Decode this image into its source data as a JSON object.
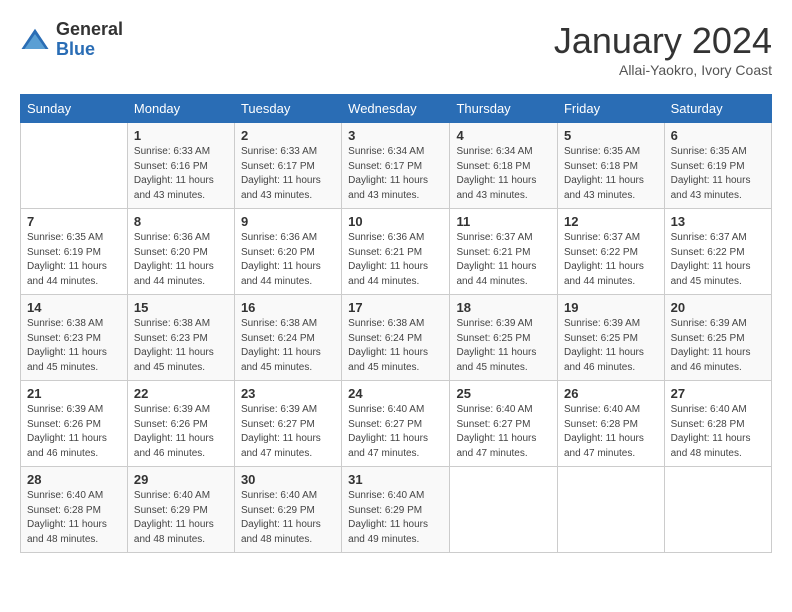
{
  "logo": {
    "general": "General",
    "blue": "Blue"
  },
  "header": {
    "month": "January 2024",
    "location": "Allai-Yaokro, Ivory Coast"
  },
  "days_of_week": [
    "Sunday",
    "Monday",
    "Tuesday",
    "Wednesday",
    "Thursday",
    "Friday",
    "Saturday"
  ],
  "weeks": [
    [
      {
        "day": "",
        "info": ""
      },
      {
        "day": "1",
        "info": "Sunrise: 6:33 AM\nSunset: 6:16 PM\nDaylight: 11 hours\nand 43 minutes."
      },
      {
        "day": "2",
        "info": "Sunrise: 6:33 AM\nSunset: 6:17 PM\nDaylight: 11 hours\nand 43 minutes."
      },
      {
        "day": "3",
        "info": "Sunrise: 6:34 AM\nSunset: 6:17 PM\nDaylight: 11 hours\nand 43 minutes."
      },
      {
        "day": "4",
        "info": "Sunrise: 6:34 AM\nSunset: 6:18 PM\nDaylight: 11 hours\nand 43 minutes."
      },
      {
        "day": "5",
        "info": "Sunrise: 6:35 AM\nSunset: 6:18 PM\nDaylight: 11 hours\nand 43 minutes."
      },
      {
        "day": "6",
        "info": "Sunrise: 6:35 AM\nSunset: 6:19 PM\nDaylight: 11 hours\nand 43 minutes."
      }
    ],
    [
      {
        "day": "7",
        "info": "Sunrise: 6:35 AM\nSunset: 6:19 PM\nDaylight: 11 hours\nand 44 minutes."
      },
      {
        "day": "8",
        "info": "Sunrise: 6:36 AM\nSunset: 6:20 PM\nDaylight: 11 hours\nand 44 minutes."
      },
      {
        "day": "9",
        "info": "Sunrise: 6:36 AM\nSunset: 6:20 PM\nDaylight: 11 hours\nand 44 minutes."
      },
      {
        "day": "10",
        "info": "Sunrise: 6:36 AM\nSunset: 6:21 PM\nDaylight: 11 hours\nand 44 minutes."
      },
      {
        "day": "11",
        "info": "Sunrise: 6:37 AM\nSunset: 6:21 PM\nDaylight: 11 hours\nand 44 minutes."
      },
      {
        "day": "12",
        "info": "Sunrise: 6:37 AM\nSunset: 6:22 PM\nDaylight: 11 hours\nand 44 minutes."
      },
      {
        "day": "13",
        "info": "Sunrise: 6:37 AM\nSunset: 6:22 PM\nDaylight: 11 hours\nand 45 minutes."
      }
    ],
    [
      {
        "day": "14",
        "info": "Sunrise: 6:38 AM\nSunset: 6:23 PM\nDaylight: 11 hours\nand 45 minutes."
      },
      {
        "day": "15",
        "info": "Sunrise: 6:38 AM\nSunset: 6:23 PM\nDaylight: 11 hours\nand 45 minutes."
      },
      {
        "day": "16",
        "info": "Sunrise: 6:38 AM\nSunset: 6:24 PM\nDaylight: 11 hours\nand 45 minutes."
      },
      {
        "day": "17",
        "info": "Sunrise: 6:38 AM\nSunset: 6:24 PM\nDaylight: 11 hours\nand 45 minutes."
      },
      {
        "day": "18",
        "info": "Sunrise: 6:39 AM\nSunset: 6:25 PM\nDaylight: 11 hours\nand 45 minutes."
      },
      {
        "day": "19",
        "info": "Sunrise: 6:39 AM\nSunset: 6:25 PM\nDaylight: 11 hours\nand 46 minutes."
      },
      {
        "day": "20",
        "info": "Sunrise: 6:39 AM\nSunset: 6:25 PM\nDaylight: 11 hours\nand 46 minutes."
      }
    ],
    [
      {
        "day": "21",
        "info": "Sunrise: 6:39 AM\nSunset: 6:26 PM\nDaylight: 11 hours\nand 46 minutes."
      },
      {
        "day": "22",
        "info": "Sunrise: 6:39 AM\nSunset: 6:26 PM\nDaylight: 11 hours\nand 46 minutes."
      },
      {
        "day": "23",
        "info": "Sunrise: 6:39 AM\nSunset: 6:27 PM\nDaylight: 11 hours\nand 47 minutes."
      },
      {
        "day": "24",
        "info": "Sunrise: 6:40 AM\nSunset: 6:27 PM\nDaylight: 11 hours\nand 47 minutes."
      },
      {
        "day": "25",
        "info": "Sunrise: 6:40 AM\nSunset: 6:27 PM\nDaylight: 11 hours\nand 47 minutes."
      },
      {
        "day": "26",
        "info": "Sunrise: 6:40 AM\nSunset: 6:28 PM\nDaylight: 11 hours\nand 47 minutes."
      },
      {
        "day": "27",
        "info": "Sunrise: 6:40 AM\nSunset: 6:28 PM\nDaylight: 11 hours\nand 48 minutes."
      }
    ],
    [
      {
        "day": "28",
        "info": "Sunrise: 6:40 AM\nSunset: 6:28 PM\nDaylight: 11 hours\nand 48 minutes."
      },
      {
        "day": "29",
        "info": "Sunrise: 6:40 AM\nSunset: 6:29 PM\nDaylight: 11 hours\nand 48 minutes."
      },
      {
        "day": "30",
        "info": "Sunrise: 6:40 AM\nSunset: 6:29 PM\nDaylight: 11 hours\nand 48 minutes."
      },
      {
        "day": "31",
        "info": "Sunrise: 6:40 AM\nSunset: 6:29 PM\nDaylight: 11 hours\nand 49 minutes."
      },
      {
        "day": "",
        "info": ""
      },
      {
        "day": "",
        "info": ""
      },
      {
        "day": "",
        "info": ""
      }
    ]
  ]
}
